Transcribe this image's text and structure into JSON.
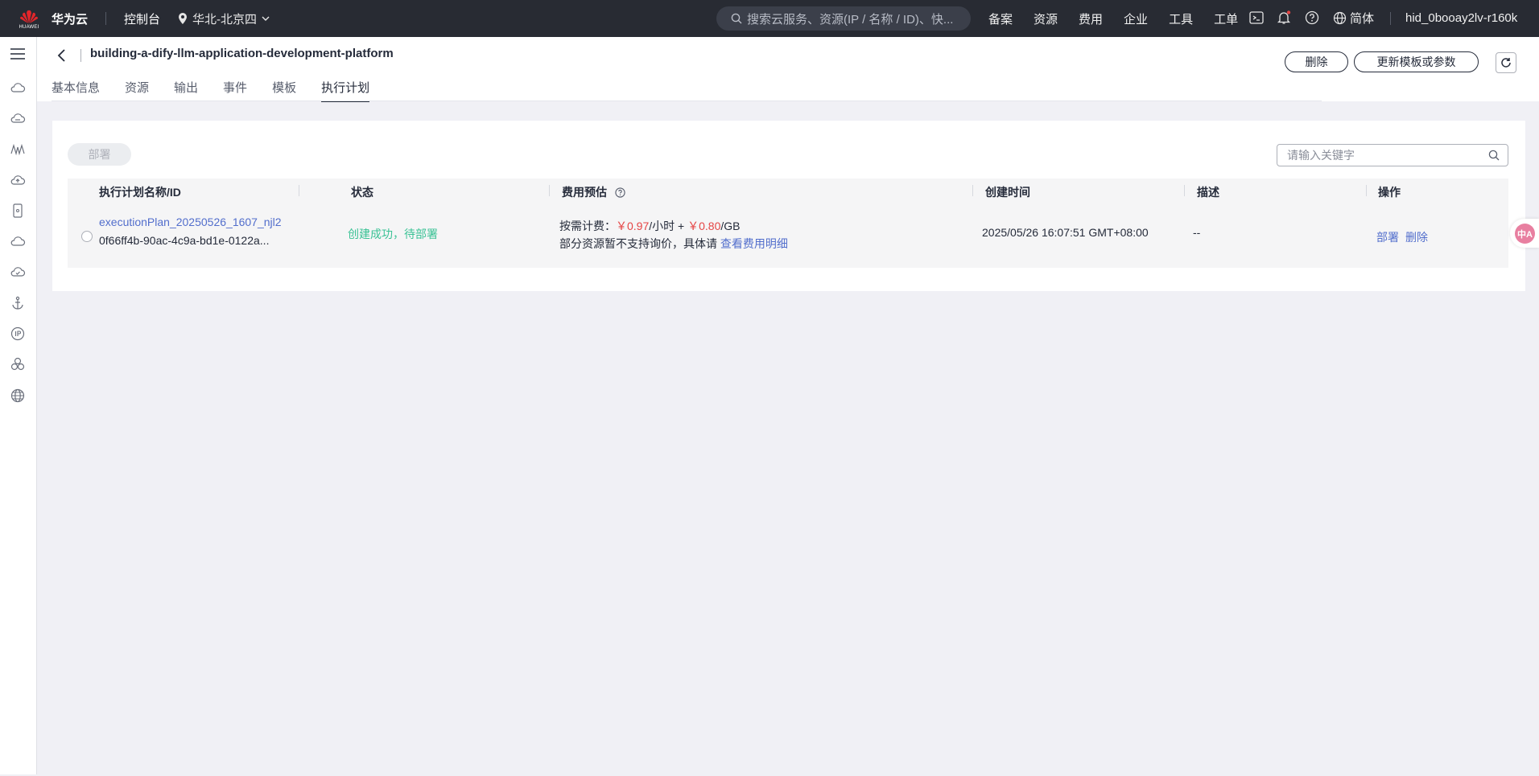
{
  "topbar": {
    "logo_sub": "HUAWEI",
    "brand": "华为云",
    "console": "控制台",
    "region": "华北-北京四",
    "search_placeholder": "搜索云服务、资源(IP / 名称 / ID)、快...",
    "nav": [
      "备案",
      "资源",
      "费用",
      "企业",
      "工具",
      "工单"
    ],
    "lang": "简体",
    "user": "hid_0booay2lv-r160k"
  },
  "rail_icons": [
    "cloud-icon",
    "cloud-server-icon",
    "analytics-icon",
    "cloud-up-icon",
    "document-icon",
    "cloud-storage-icon",
    "cloud-ok-icon",
    "anchor-icon",
    "ip-icon",
    "cluster-icon",
    "globe-icon"
  ],
  "header": {
    "title": "building-a-dify-llm-application-development-platform",
    "delete_label": "删除",
    "update_label": "更新模板或参数",
    "tabs": [
      "基本信息",
      "资源",
      "输出",
      "事件",
      "模板",
      "执行计划"
    ],
    "active_tab": "执行计划"
  },
  "toolbar": {
    "deploy_label": "部署",
    "keyword_placeholder": "请输入关键字"
  },
  "table": {
    "columns": [
      "执行计划名称/ID",
      "状态",
      "费用预估",
      "创建时间",
      "描述",
      "操作"
    ],
    "rows": [
      {
        "name": "executionPlan_20250526_1607_njl2",
        "id": "0f66ff4b-90ac-4c9a-bd1e-0122a...",
        "status": "创建成功，待部署",
        "cost_prefix": "按需计费：",
        "cost_hour": "￥0.97",
        "cost_hour_unit": "/小时 + ",
        "cost_gb": "￥0.80",
        "cost_gb_unit": "/GB",
        "cost_note": "部分资源暂不支持询价，具体请 ",
        "cost_link": "查看费用明细",
        "created": "2025/05/26 16:07:51 GMT+08:00",
        "description": "--",
        "op_deploy": "部署",
        "op_delete": "删除"
      }
    ]
  },
  "float_widget": "中A",
  "colors": {
    "topbar": "#282b33",
    "link": "#526ecc",
    "success": "#3ac295",
    "price": "#e54545"
  }
}
